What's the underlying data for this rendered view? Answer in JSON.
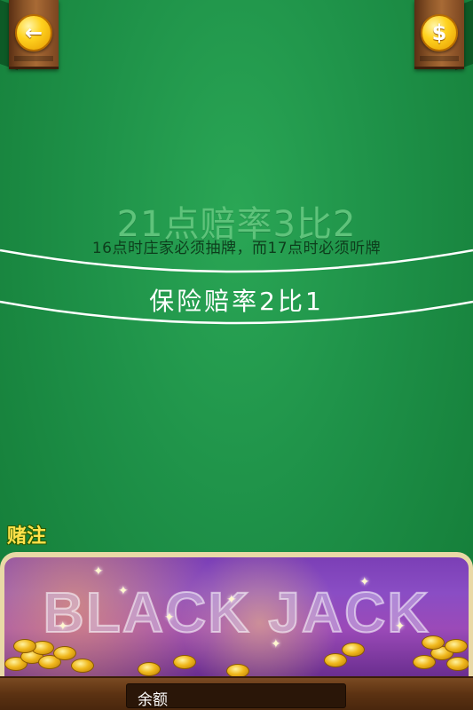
{
  "header": {
    "back_icon": "arrow-left-icon",
    "shop_icon": "dollar-coin-icon",
    "back_glyph": "←",
    "shop_glyph": "$"
  },
  "table": {
    "payout_21": "21点赔率3比2",
    "dealer_rule": "16点时庄家必须抽牌，而17点时必须听牌",
    "insurance": "保险赔率2比1"
  },
  "bet": {
    "label": "赌注"
  },
  "banner": {
    "logo_text": "BLACK JACK"
  },
  "footer": {
    "balance_label": "余额"
  },
  "colors": {
    "felt": "#1e9148",
    "accent_gold": "#ffd21f",
    "banner_purple": "#8a4dc4"
  }
}
